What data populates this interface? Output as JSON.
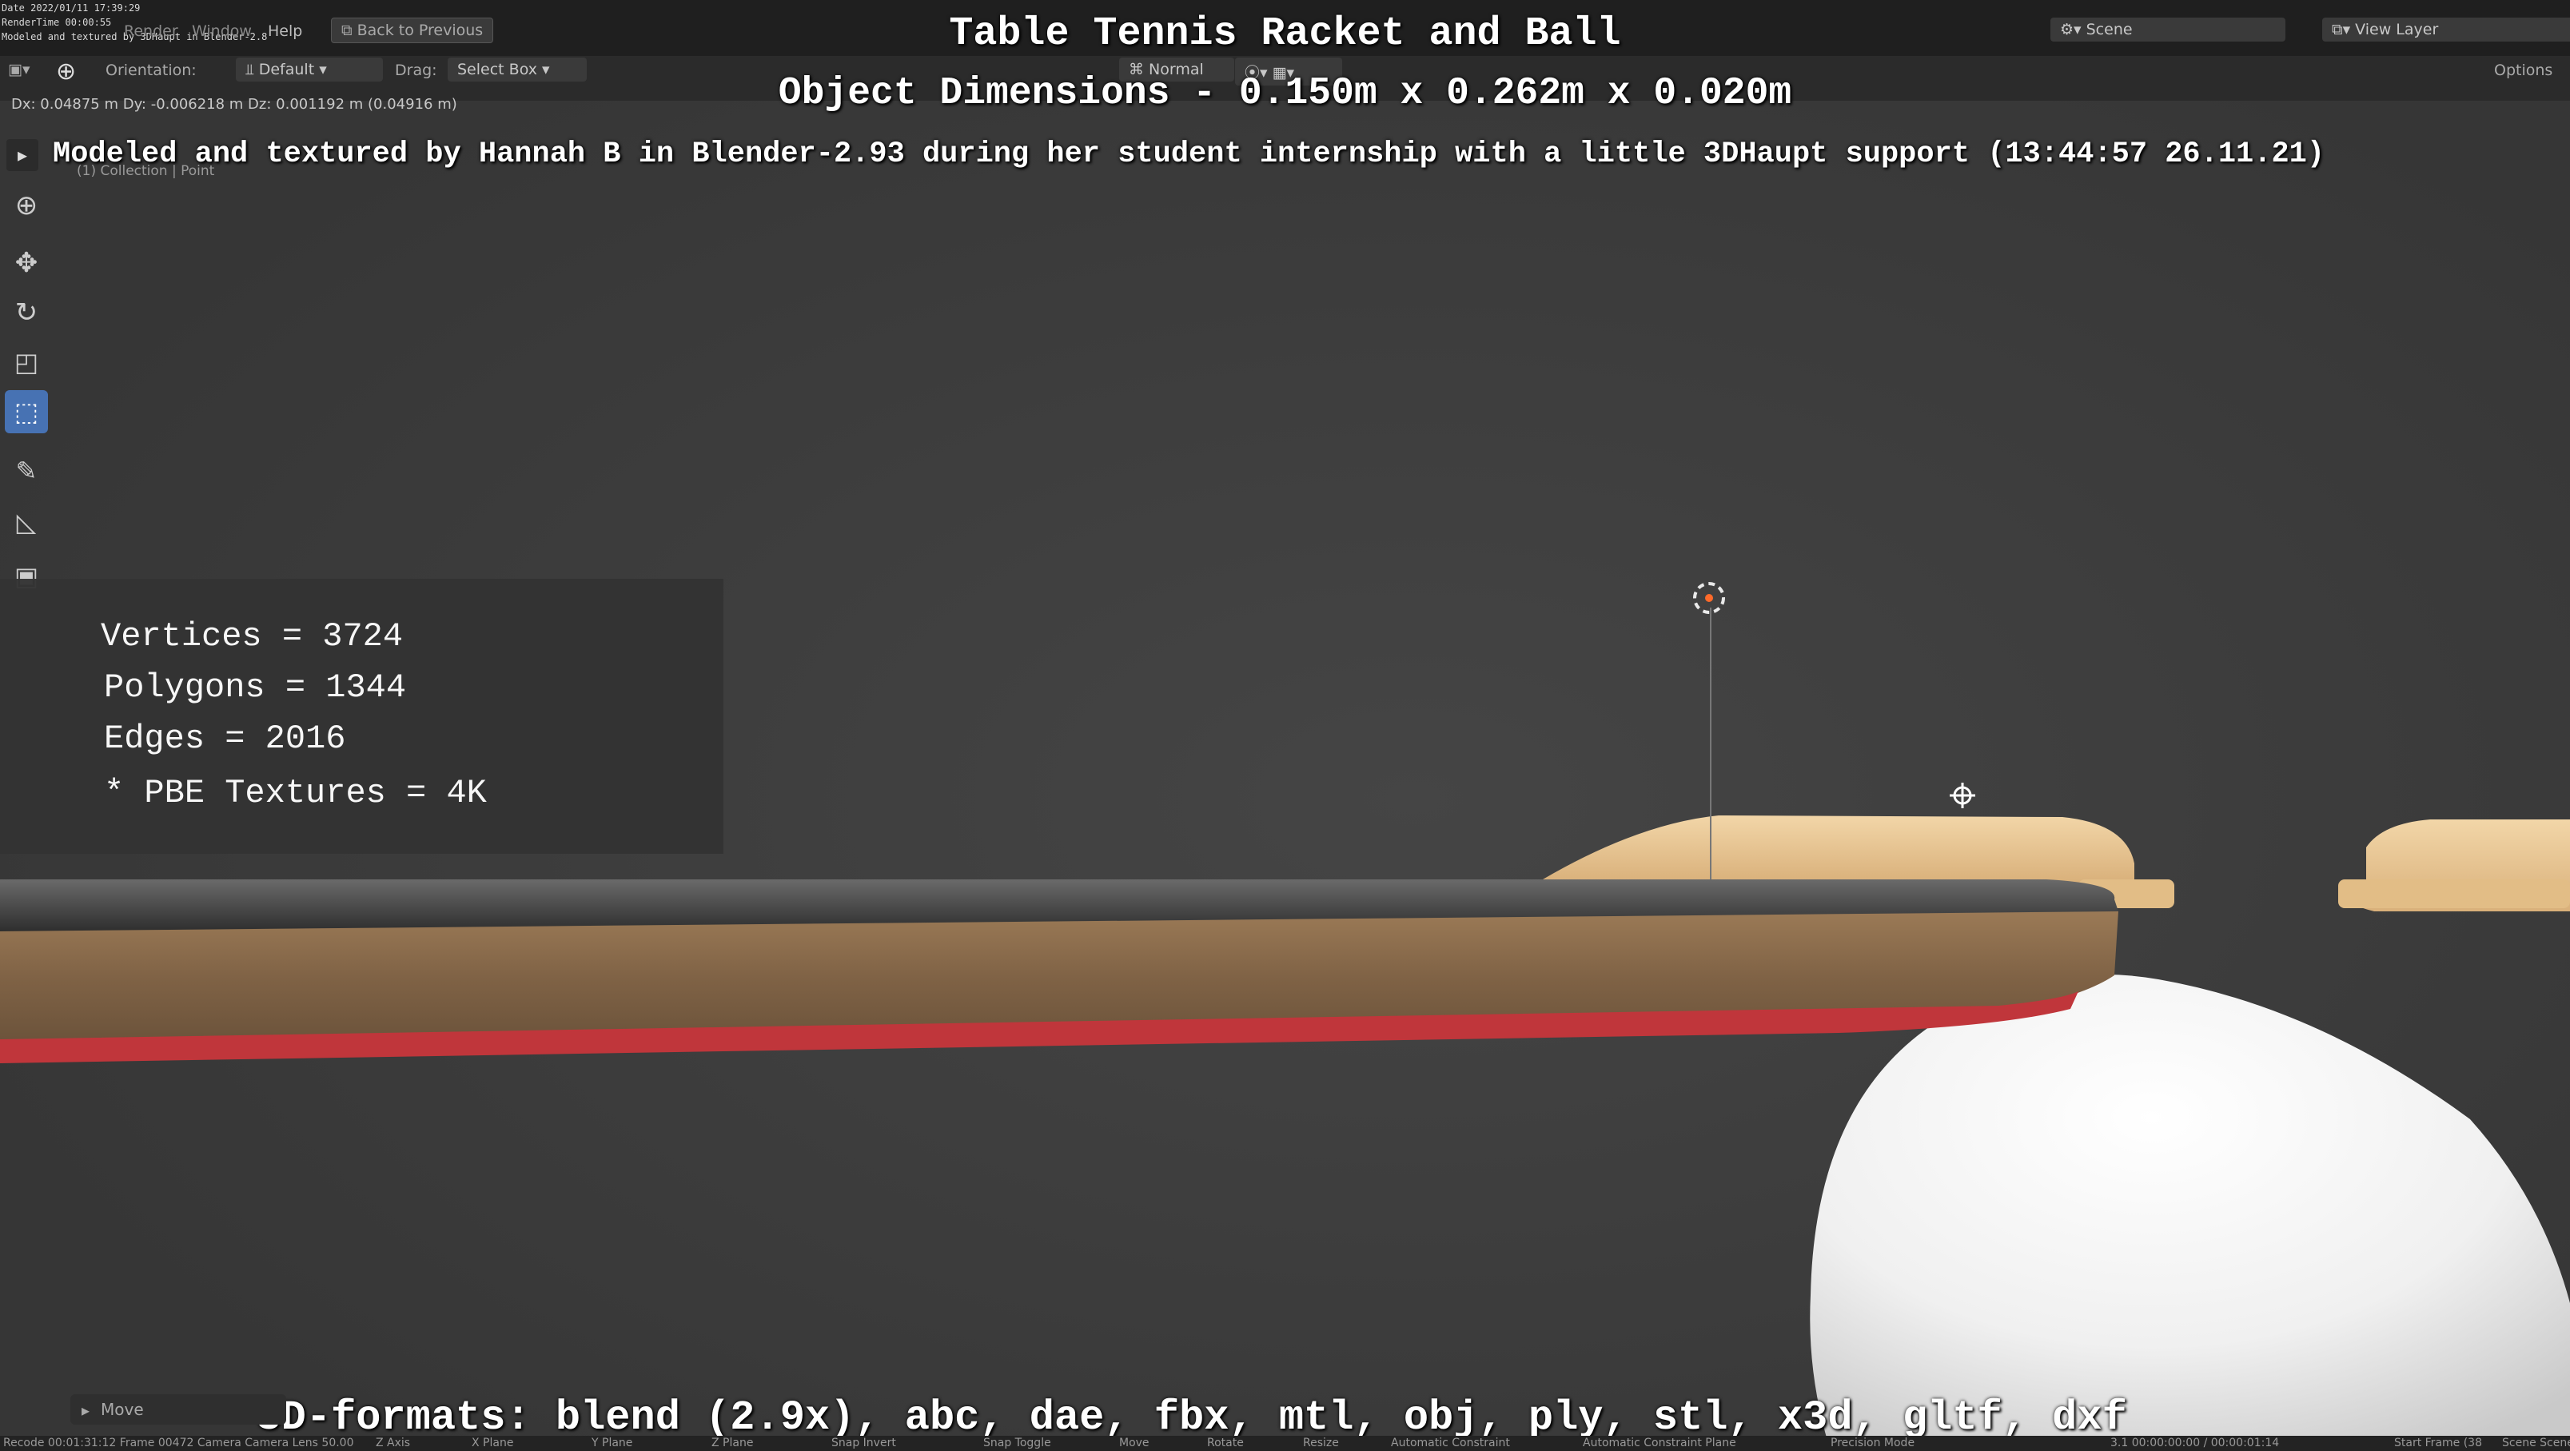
{
  "stamp": {
    "date": "Date 2022/01/11 17:39:29",
    "rendertime": "RenderTime 00:00:55",
    "credit": "Modeled and textured by 3DHaupt in Blender-2.8"
  },
  "menu": [
    "Render",
    "Window",
    "Help"
  ],
  "back_button": "Back to Previous",
  "scene_label": "Scene",
  "view_layer_label": "View Layer",
  "header": {
    "orientation_label": "Orientation:",
    "orientation_value": "Default",
    "drag_label": "Drag:",
    "drag_value": "Select Box",
    "pivot_value": "Normal",
    "options_label": "Options"
  },
  "status_line": "Dx: 0.04875 m  Dy: -0.006218 m  Dz: 0.001192 m (0.04916 m)",
  "collection_line": "(1) Collection | Point",
  "overlay": {
    "title": "Table Tennis Racket and Ball",
    "dimensions": "Object Dimensions -  0.150m x 0.262m x 0.020m",
    "credit": "Modeled and textured by Hannah B in Blender-2.93 during her student internship with a little 3DHaupt support (13:44:57 26.11.21)",
    "formats": "* 3D-formats: blend (2.9x), abc, dae, fbx, mtl, obj, ply, stl, x3d, gltf, dxf"
  },
  "stats": {
    "vertices": "Vertices = 3724",
    "polygons": "Polygons = 1344",
    "edges": "Edges = 2016",
    "textures": "* PBE Textures = 4K"
  },
  "move_panel": "Move",
  "statusbar": {
    "left": "Recode 00:01:31:12   Frame 00472   Camera Camera   Lens 50.00",
    "keys": [
      "Z Axis",
      "X Plane",
      "Y Plane",
      "Z Plane",
      "Snap Invert",
      "Snap Toggle",
      "Move",
      "Rotate",
      "Resize",
      "Automatic Constraint",
      "Automatic Constraint Plane",
      "Precision Mode"
    ],
    "right_time": "3.1  00:00:00:00 / 00:00:01:14",
    "start_frame": "Start Frame (38",
    "scene": "Scene Scene"
  },
  "colors": {
    "viewport_bg": "#3c3c3c",
    "accent": "#4772b3",
    "rubber_top": "#4a4a4a",
    "rubber_bottom": "#c83a3a",
    "blade": "#8a6a48",
    "handle": "#e8c592",
    "ball": "#f2f2f2"
  },
  "icons": [
    "select-cursor-icon",
    "cursor-icon",
    "move-icon",
    "rotate-icon",
    "scale-icon",
    "transform-icon",
    "annotate-icon",
    "measure-icon",
    "add-cube-icon"
  ]
}
